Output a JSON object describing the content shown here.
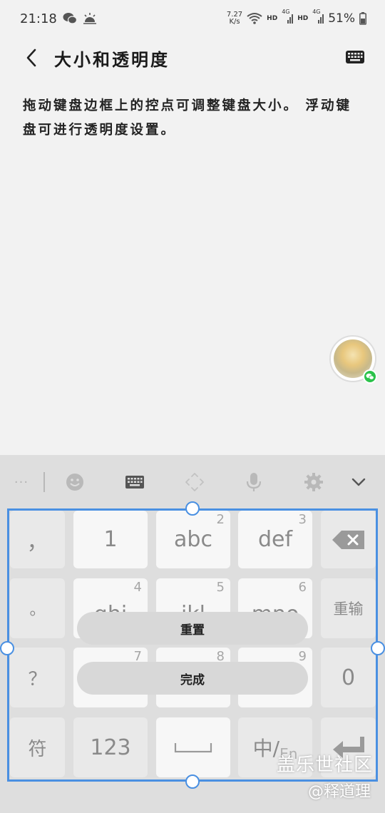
{
  "status_bar": {
    "time": "21:18",
    "net_speed_value": "7.27",
    "net_speed_unit": "K/s",
    "hd1": "HD",
    "sig1": "4G",
    "hd2": "HD",
    "sig2": "4G",
    "battery": "51%"
  },
  "header": {
    "title": "大小和透明度"
  },
  "description": "拖动键盘边框上的控点可调整键盘大小。 浮动键盘可进行透明度设置。",
  "keyboard": {
    "toolbar": {
      "more": "···"
    },
    "keys": {
      "comma": "，",
      "one": "1",
      "abc": "abc",
      "abc_num": "2",
      "def": "def",
      "def_num": "3",
      "period": "。",
      "ghi": "ghi",
      "ghi_num": "4",
      "jkl": "jkl",
      "jkl_num": "5",
      "mno": "mno",
      "mno_num": "6",
      "reenter": "重输",
      "question": "？",
      "pqrs_num": "7",
      "tuv_num": "8",
      "wxyz_num": "9",
      "zero": "0",
      "symbol": "符",
      "num123": "123",
      "lang_zh": "中/",
      "lang_en": "En"
    },
    "reset_label": "重置",
    "done_label": "完成"
  },
  "watermark": {
    "line1": "盖乐世社区",
    "line2": "@释道理"
  },
  "colors": {
    "accent_frame": "#4a90e2",
    "wechat_green": "#2bc24a",
    "background": "#f2f2f2",
    "keyboard_bg": "#dedede"
  }
}
